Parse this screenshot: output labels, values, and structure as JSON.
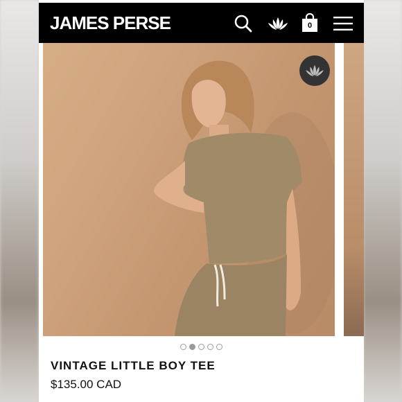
{
  "header": {
    "brand": "JAMES PERSE",
    "bag_count": "0",
    "icons": [
      "search-icon",
      "lotus-icon",
      "shopping-bag-icon",
      "menu-icon"
    ]
  },
  "gallery": {
    "badge_icon": "lotus-icon",
    "slides_total": 5,
    "active_slide": 2
  },
  "product": {
    "title": "VINTAGE LITTLE BOY TEE",
    "price": "$135.00 CAD"
  },
  "colors": {
    "header_bg": "#000000",
    "background": "#ffffff",
    "text": "#111111"
  }
}
